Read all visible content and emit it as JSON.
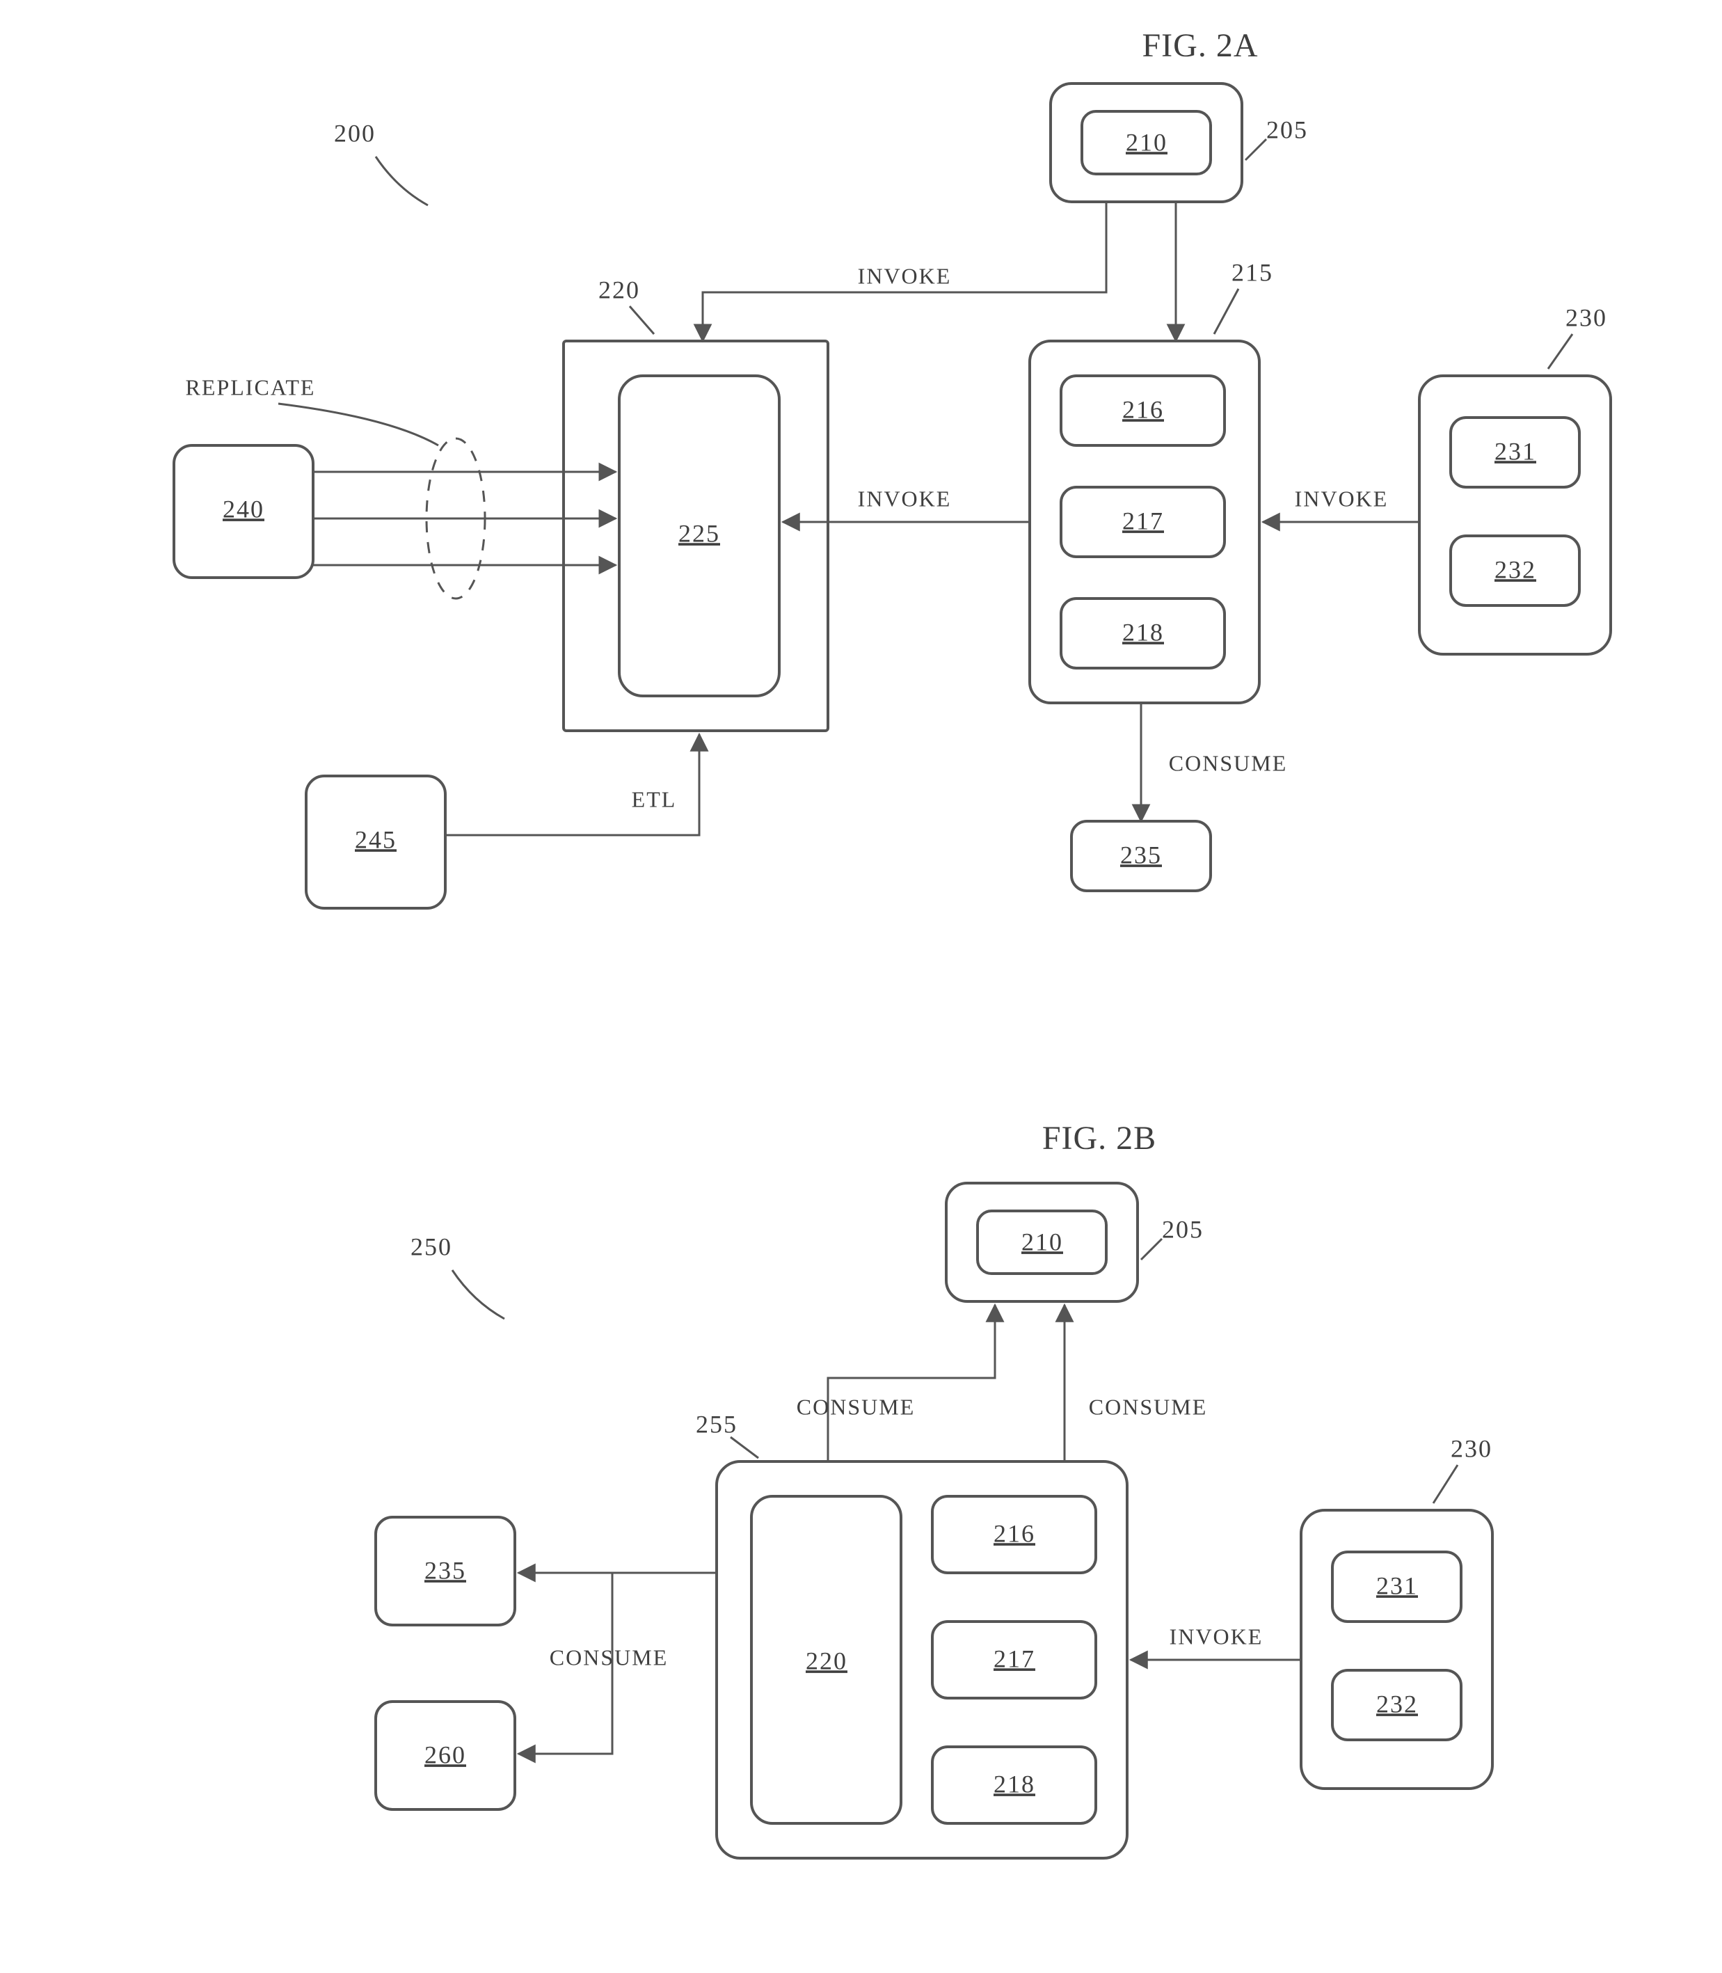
{
  "figA": {
    "title": "FIG. 2A",
    "diagramRef": "200",
    "outer205": "205",
    "n210": "210",
    "n215": "215",
    "n216": "216",
    "n217": "217",
    "n218": "218",
    "n220": "220",
    "n225": "225",
    "n230": "230",
    "n231": "231",
    "n232": "232",
    "n235": "235",
    "n240": "240",
    "n245": "245",
    "replicate": "REPLICATE",
    "invoke": "INVOKE",
    "etl": "ETL",
    "consume": "CONSUME"
  },
  "figB": {
    "title": "FIG. 2B",
    "diagramRef": "250",
    "outer205": "205",
    "n210": "210",
    "n216": "216",
    "n217": "217",
    "n218": "218",
    "n220": "220",
    "n230": "230",
    "n231": "231",
    "n232": "232",
    "n235": "235",
    "n255": "255",
    "n260": "260",
    "consume": "CONSUME",
    "invoke": "INVOKE"
  }
}
